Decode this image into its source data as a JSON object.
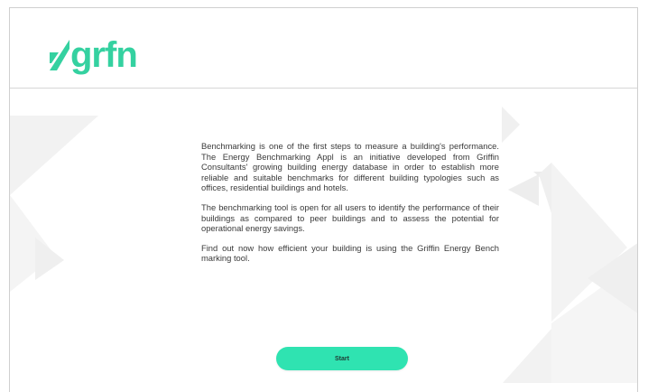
{
  "brand": {
    "logo_text": "grfn",
    "logo_icon": "leaf-logo-icon",
    "accent_color": "#34d1a0"
  },
  "intro": {
    "paragraphs": [
      "Benchmarking is one of the first steps to measure a building's performance. The Energy Benchmarking Appl is an initiative developed from Griffin Consultants' growing building energy database in order to establish more reliable and suitable benchmarks for different building typologies such as offices, residential buildings and hotels.",
      "The benchmarking tool is open for all users to identify the performance of their buildings as compared to peer buildings and to assess the potential for operational energy savings.",
      "Find out now how efficient your building is using the Griffin Energy Bench marking tool."
    ]
  },
  "actions": {
    "start_label": "Start",
    "start_color": "#2fe3b1"
  }
}
